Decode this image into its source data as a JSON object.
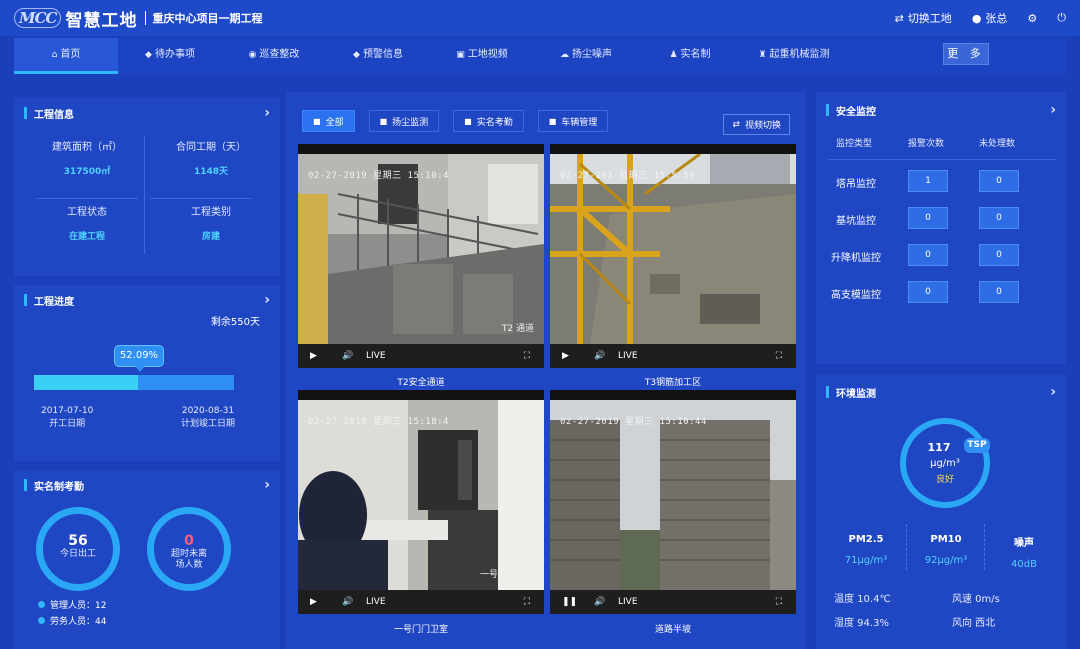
{
  "header": {
    "logo_mark": "MCC",
    "logo_name": "智慧工地",
    "project_name": "重庆中心项目一期工程",
    "switch_project": "切换工地",
    "user_name": "张总"
  },
  "nav": {
    "items": [
      {
        "label": "首页",
        "icon": "home-icon",
        "active": true
      },
      {
        "label": "待办事项",
        "icon": "shield-icon"
      },
      {
        "label": "巡查整改",
        "icon": "search-icon"
      },
      {
        "label": "预警信息",
        "icon": "shield-icon"
      },
      {
        "label": "工地视频",
        "icon": "video-icon"
      },
      {
        "label": "扬尘噪声",
        "icon": "cloud-icon"
      },
      {
        "label": "实名制",
        "icon": "users-icon"
      },
      {
        "label": "起重机械监测",
        "icon": "crane-icon"
      }
    ],
    "more_label": "更 多"
  },
  "project_info": {
    "title": "工程信息",
    "building_area_label": "建筑面积（㎡）",
    "building_area_value": "317500㎡",
    "contract_period_label": "合同工期（天）",
    "contract_period_value": "1148天",
    "status_label": "工程状态",
    "status_value": "在建工程",
    "category_label": "工程类别",
    "category_value": "房建"
  },
  "progress": {
    "title": "工程进度",
    "remaining": "剩余550天",
    "percent_label": "52.09%",
    "percent_value": 52.09,
    "start_date": "2017-07-10",
    "start_label": "开工日期",
    "end_date": "2020-08-31",
    "end_label": "计划竣工日期"
  },
  "attendance": {
    "title": "实名制考勤",
    "today_count": "56",
    "today_label": "今日出工",
    "overdue_count": "0",
    "overdue_label_1": "超时未离",
    "overdue_label_2": "场人数",
    "managers": "管理人员：12",
    "workers": "劳务人员：44"
  },
  "video": {
    "tabs": [
      {
        "label": "全部",
        "active": true
      },
      {
        "label": "扬尘监测"
      },
      {
        "label": "实名考勤"
      },
      {
        "label": "车辆管理"
      }
    ],
    "switch_label": "视频切换",
    "live_label": "LIVE",
    "feeds": [
      {
        "caption": "T2安全通道",
        "stamp": "02-27-2019 星期三 15:10:4",
        "overlay": "T2  通道",
        "playing": true
      },
      {
        "caption": "T3钢筋加工区",
        "stamp": "02-27-201  星期三 15:5:59",
        "overlay": "",
        "playing": true
      },
      {
        "caption": "一号门门卫室",
        "stamp": "02-27-2019 星期三 15:18:4",
        "overlay": "一号门门卫室",
        "playing": true
      },
      {
        "caption": "道路半坡",
        "stamp": "02-27-2019 星期三 15:10:44",
        "overlay": "",
        "playing": false
      }
    ]
  },
  "safety": {
    "title": "安全监控",
    "col_type": "监控类型",
    "col_alarm": "报警次数",
    "col_pending": "未处理数",
    "rows": [
      {
        "label": "塔吊监控",
        "alarm": "1",
        "pending": "0"
      },
      {
        "label": "基坑监控",
        "alarm": "0",
        "pending": "0"
      },
      {
        "label": "升降机监控",
        "alarm": "0",
        "pending": "0"
      },
      {
        "label": "高支模监控",
        "alarm": "0",
        "pending": "0"
      }
    ]
  },
  "environment": {
    "title": "环境监测",
    "tsp_value": "117",
    "tsp_unit": "μg/m³",
    "tsp_quality": "良好",
    "tsp_tag": "TSP",
    "pm25_label": "PM2.5",
    "pm25_value": "71μg/m³",
    "pm10_label": "PM10",
    "pm10_value": "92μg/m³",
    "noise_label": "噪声",
    "noise_value": "40dB",
    "temperature": "温度 10.4℃",
    "wind_speed": "风速 0m/s",
    "humidity": "湿度 94.3%",
    "wind_dir": "风向 西北"
  }
}
